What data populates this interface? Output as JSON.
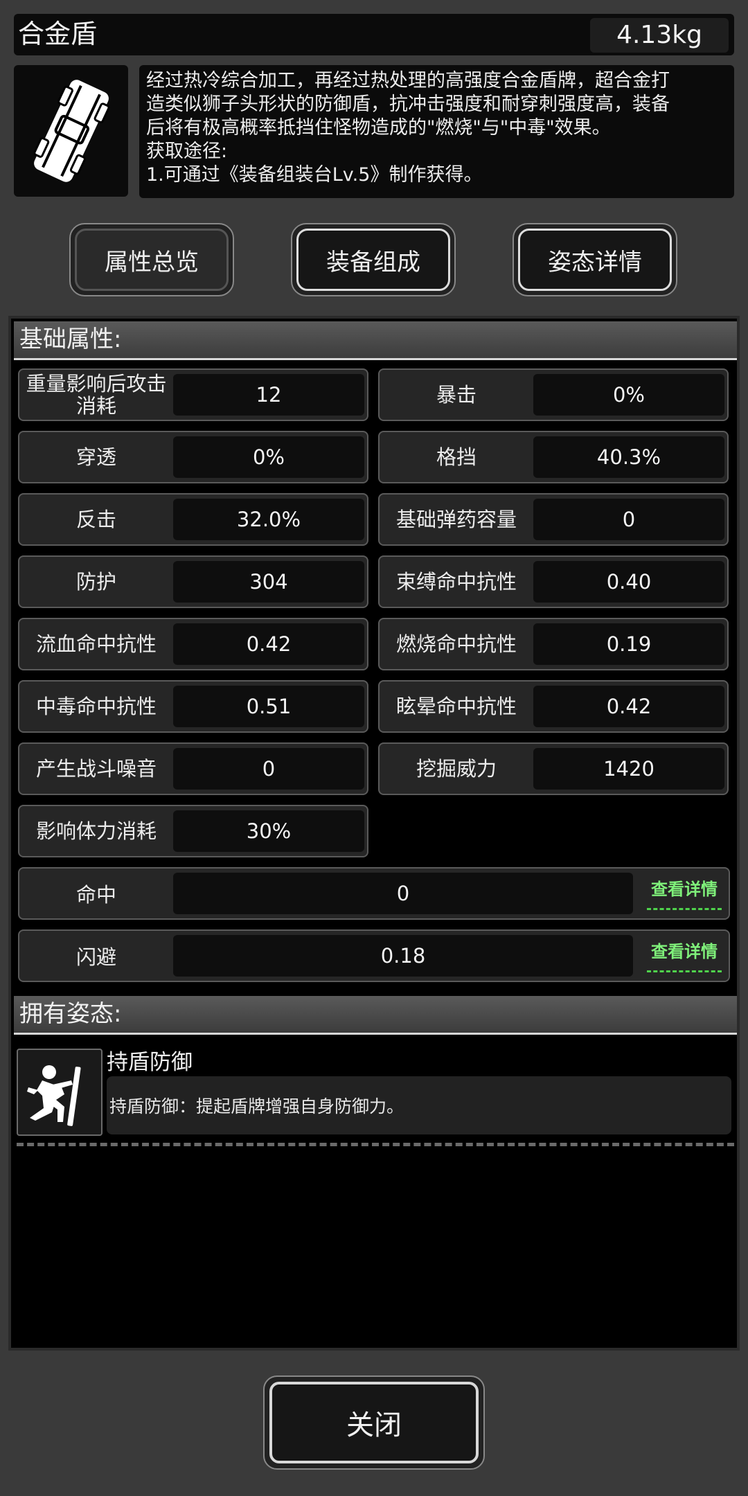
{
  "item": {
    "name": "合金盾",
    "weight": "4.13kg",
    "icon": "shield-icon",
    "description": [
      "经过热冷综合加工，再经过热处理的高强度合金盾牌，超合金打",
      "造类似狮子头形状的防御盾，抗冲击强度和耐穿刺强度高，装备",
      "后将有极高概率抵挡住怪物造成的\"燃烧\"与\"中毒\"效果。",
      "获取途径:",
      "1.可通过《装备组装台Lv.5》制作获得。"
    ]
  },
  "tabs": [
    {
      "label": "属性总览"
    },
    {
      "label": "装备组成"
    },
    {
      "label": "姿态详情"
    }
  ],
  "basic": {
    "title": "基础属性:",
    "stats": [
      {
        "label": "重量影响后攻击消耗",
        "value": "12"
      },
      {
        "label": "暴击",
        "value": "0%"
      },
      {
        "label": "穿透",
        "value": "0%"
      },
      {
        "label": "格挡",
        "value": "40.3%"
      },
      {
        "label": "反击",
        "value": "32.0%"
      },
      {
        "label": "基础弹药容量",
        "value": "0"
      },
      {
        "label": "防护",
        "value": "304"
      },
      {
        "label": "束缚命中抗性",
        "value": "0.40"
      },
      {
        "label": "流血命中抗性",
        "value": "0.42"
      },
      {
        "label": "燃烧命中抗性",
        "value": "0.19"
      },
      {
        "label": "中毒命中抗性",
        "value": "0.51"
      },
      {
        "label": "眩晕命中抗性",
        "value": "0.42"
      },
      {
        "label": "产生战斗噪音",
        "value": "0"
      },
      {
        "label": "挖掘威力",
        "value": "1420"
      },
      {
        "label": "影响体力消耗",
        "value": "30%"
      }
    ],
    "wide": [
      {
        "label": "命中",
        "value": "0",
        "detail": "查看详情"
      },
      {
        "label": "闪避",
        "value": "0.18",
        "detail": "查看详情"
      }
    ]
  },
  "stance_section": {
    "title": "拥有姿态:",
    "stance": {
      "name": "持盾防御",
      "description": "持盾防御：提起盾牌增强自身防御力。",
      "icon": "shield-stance-icon"
    }
  },
  "footer": {
    "close_label": "关闭"
  }
}
